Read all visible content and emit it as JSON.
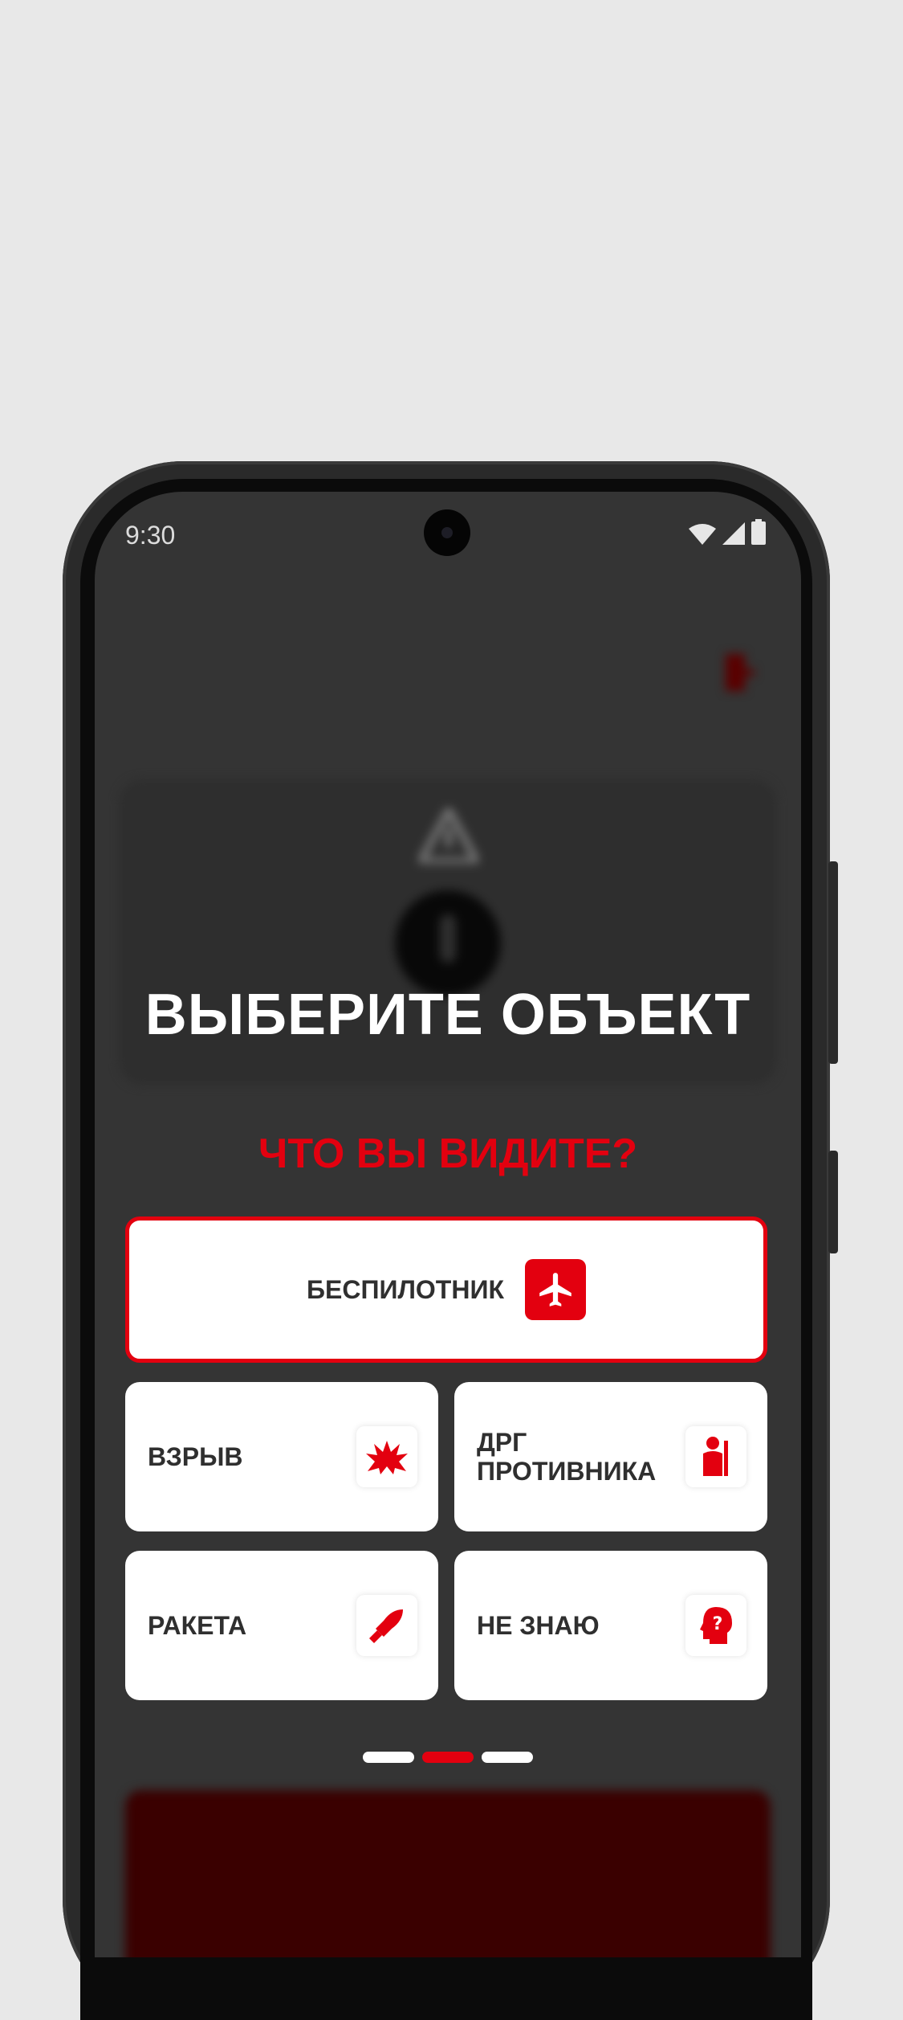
{
  "status_bar": {
    "time": "9:30"
  },
  "background": {
    "brand": "",
    "report_button": ""
  },
  "modal": {
    "title": "ВЫБЕРИТЕ ОБЪЕКТ",
    "question": "ЧТО ВЫ ВИДИТЕ?",
    "options": [
      {
        "label": "БЕСПИЛОТНИК",
        "icon": "airplane-icon",
        "selected": true
      },
      {
        "label": "ВЗРЫВ",
        "icon": "explosion-icon",
        "selected": false
      },
      {
        "label": "ДРГ\nПРОТИВНИКА",
        "icon": "soldier-icon",
        "selected": false
      },
      {
        "label": "РАКЕТА",
        "icon": "rocket-icon",
        "selected": false
      },
      {
        "label": "НЕ ЗНАЮ",
        "icon": "question-head-icon",
        "selected": false
      }
    ],
    "pager": {
      "pages": 3,
      "active_index": 1
    }
  },
  "colors": {
    "accent": "#e3000f",
    "screen_bg": "#343434",
    "card_bg": "#ffffff",
    "text_dark": "#2f2f2f"
  }
}
